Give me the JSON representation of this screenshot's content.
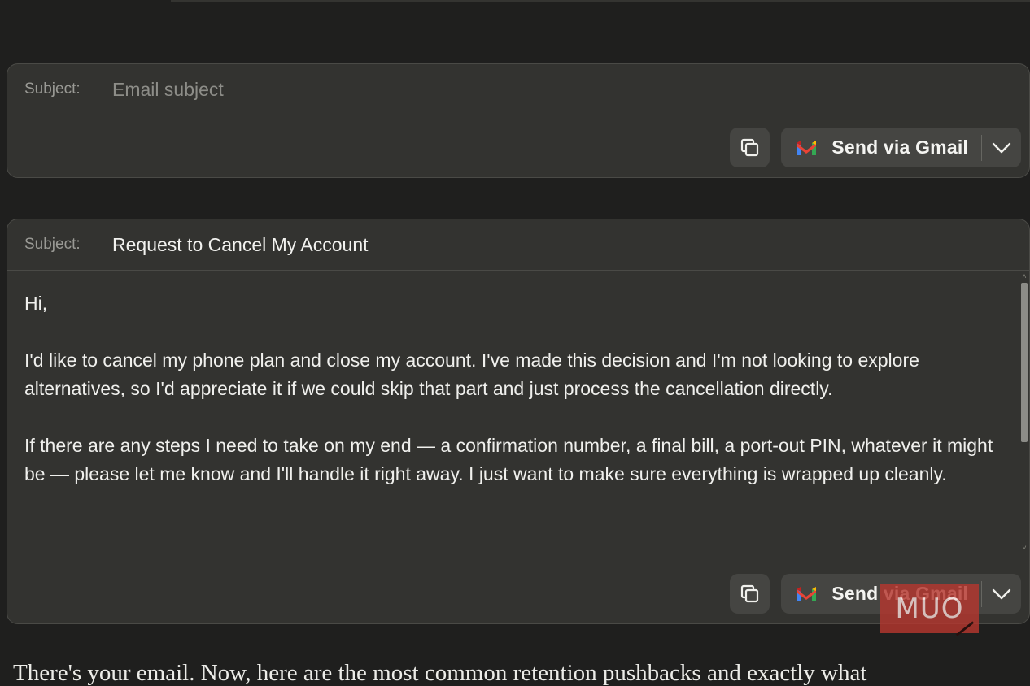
{
  "email_card_empty": {
    "subject_label": "Subject:",
    "subject_placeholder": "Email subject",
    "subject_value": "",
    "send_label": "Send via Gmail"
  },
  "email_card_filled": {
    "subject_label": "Subject:",
    "subject_value": "Request to Cancel My Account",
    "body_paragraphs": [
      "Hi,",
      "I'd like to cancel my phone plan and close my account. I've made this decision and I'm not looking to explore alternatives, so I'd appreciate it if we could skip that part and just process the cancellation directly.",
      "If there are any steps I need to take on my end — a confirmation number, a final bill, a port-out PIN, whatever it might be — please let me know and I'll handle it right away. I just want to make sure everything is wrapped up cleanly."
    ],
    "send_label": "Send via Gmail"
  },
  "watermark": {
    "text": "MUO"
  },
  "article": {
    "text": "There's your email. Now, here are the most common retention pushbacks and exactly what"
  },
  "icons": {
    "copy": "copy-icon",
    "gmail": "gmail-icon",
    "dropdown": "chevron-down-icon"
  },
  "colors": {
    "background": "#1f1f1e",
    "card": "#333330",
    "button": "#454542",
    "watermark": "#b5372f"
  }
}
